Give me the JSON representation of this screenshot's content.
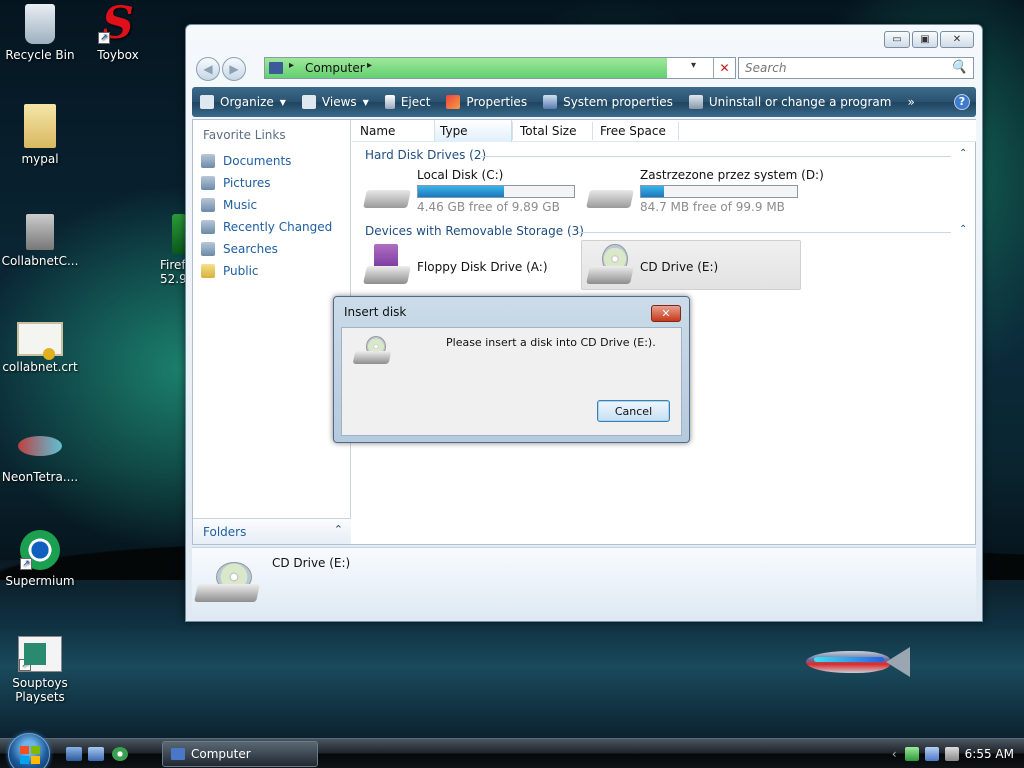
{
  "desktop": {
    "icons": [
      {
        "label": "Recycle Bin"
      },
      {
        "label": "Toybox",
        "glyph": "S"
      },
      {
        "label": "mypal"
      },
      {
        "label": "CollabnetC..."
      },
      {
        "label": "Firef 52.9"
      },
      {
        "label": "collabnet.crt"
      },
      {
        "label": "NeonTetra...."
      },
      {
        "label": "Supermium"
      },
      {
        "label": "Souptoys Playsets"
      }
    ]
  },
  "window": {
    "controls": {
      "minimize": "▭",
      "maximize": "▣",
      "close": "✕"
    },
    "nav": {
      "back": "◀",
      "forward": "▶"
    },
    "address": {
      "crumb": "Computer",
      "separator": "▸",
      "dropdown": "▾",
      "clear": "✕"
    },
    "search": {
      "placeholder": "Search",
      "icon": "🔍"
    },
    "toolbar": {
      "items": [
        {
          "label": "Organize",
          "icon": "organize-icon",
          "has_caret": true
        },
        {
          "label": "Views",
          "icon": "views-icon",
          "has_caret": true
        },
        {
          "label": "Eject",
          "icon": "eject-icon"
        },
        {
          "label": "Properties",
          "icon": "properties-icon"
        },
        {
          "label": "System properties",
          "icon": "system-properties-icon"
        },
        {
          "label": "Uninstall or change a program",
          "icon": "uninstall-icon"
        }
      ],
      "more": "»",
      "help": "?",
      "caret": "▼"
    },
    "nav_pane": {
      "title": "Favorite Links",
      "links": [
        "Documents",
        "Pictures",
        "Music",
        "Recently Changed",
        "Searches",
        "Public"
      ],
      "folders_label": "Folders",
      "folders_chevron": "⌃"
    },
    "columns": [
      "Name",
      "Type",
      "Total Size",
      "Free Space"
    ],
    "groups": [
      {
        "title": "Hard Disk Drives (2)",
        "chevron": "⌃",
        "drives": [
          {
            "name": "Local Disk (C:)",
            "free_text": "4.46 GB free of 9.89 GB",
            "used_fraction": 0.55
          },
          {
            "name": "Zastrzezone przez system (D:)",
            "free_text": "84.7 MB free of 99.9 MB",
            "used_fraction": 0.15
          }
        ]
      },
      {
        "title": "Devices with Removable Storage (3)",
        "chevron": "⌃",
        "drives": [
          {
            "name": "Floppy Disk Drive (A:)"
          },
          {
            "name": "CD Drive (E:)",
            "selected": true
          }
        ]
      }
    ],
    "details_pane": {
      "label": "CD Drive (E:)"
    }
  },
  "dialog": {
    "title": "Insert disk",
    "close": "✕",
    "message": "Please insert a disk into CD Drive (E:).",
    "cancel_label": "Cancel"
  },
  "taskbar": {
    "task_label": "Computer",
    "clock": "6:55 AM",
    "tray_arrow": "‹"
  },
  "colors": {
    "toolbar": "#2a526f",
    "link": "#1f5fa0",
    "progress": "#1a78c0",
    "address_fill": "#62d070"
  }
}
